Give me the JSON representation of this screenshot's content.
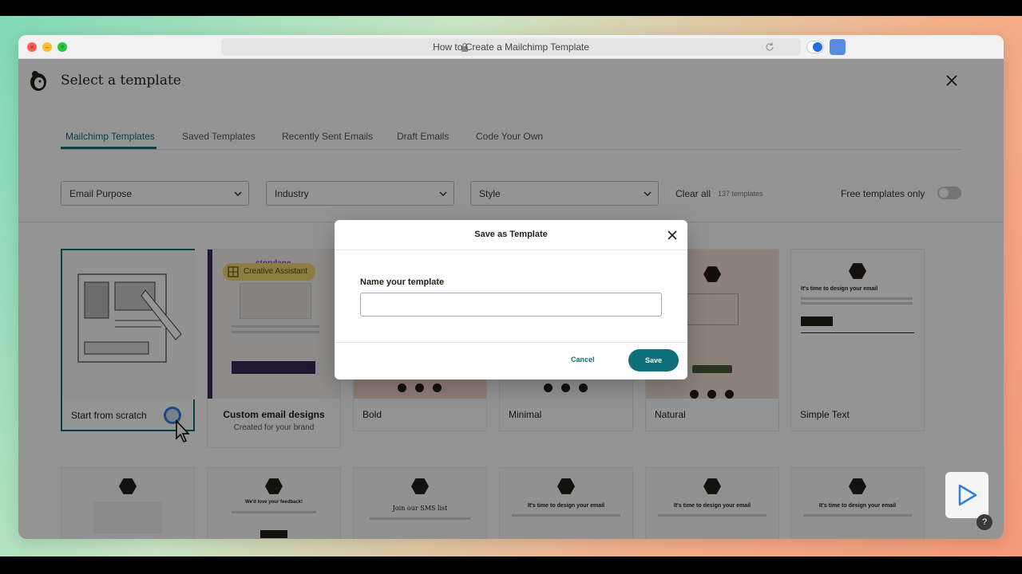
{
  "browser": {
    "url_title": "How to Create a Mailchimp Template"
  },
  "app": {
    "title": "Select a template"
  },
  "tabs": [
    {
      "label": "Mailchimp Templates",
      "active": true
    },
    {
      "label": "Saved Templates",
      "active": false
    },
    {
      "label": "Recently Sent Emails",
      "active": false
    },
    {
      "label": "Draft Emails",
      "active": false
    },
    {
      "label": "Code Your Own",
      "active": false
    }
  ],
  "filters": {
    "email_purpose": "Email Purpose",
    "industry": "Industry",
    "style": "Style",
    "clear_all": "Clear all",
    "count": "137 templates",
    "free_only": "Free templates only",
    "free_only_on": false
  },
  "badge": {
    "label": "Creative Assistant"
  },
  "cards": [
    {
      "label": "Start from scratch",
      "selected": true
    },
    {
      "label": "Custom email designs",
      "sublabel": "Created for your brand"
    },
    {
      "label": "Bold"
    },
    {
      "label": "Minimal"
    },
    {
      "label": "Natural"
    },
    {
      "label": "Simple Text"
    }
  ],
  "thumb_text": {
    "storylane": "storylane",
    "heading_design": "It's time to design your email",
    "feedback": "We'd love your feedback!",
    "sms": "Join our SMS list",
    "logo": "ADD YOUR LOGO"
  },
  "modal": {
    "title": "Save as Template",
    "field_label": "Name your template",
    "field_value": "",
    "cancel": "Cancel",
    "save": "Save"
  },
  "help": "?",
  "colors": {
    "accent": "#0e6f7a",
    "badge": "#f5d76e"
  }
}
